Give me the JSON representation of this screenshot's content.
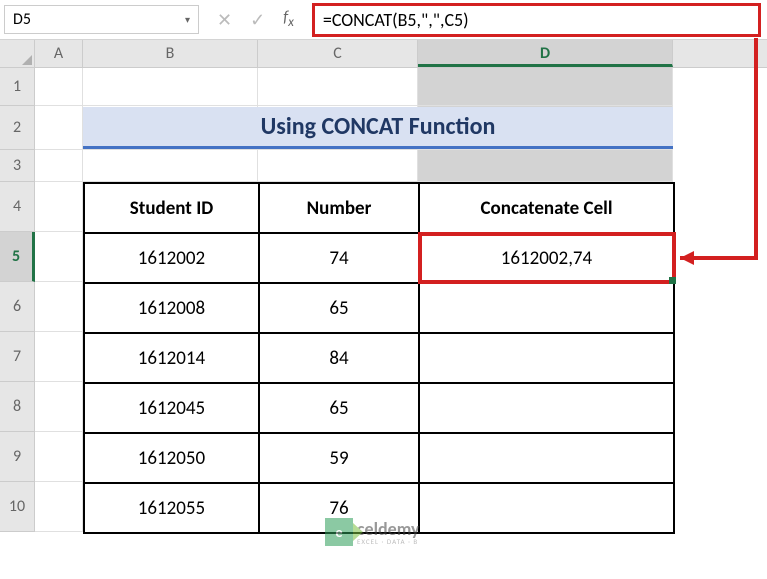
{
  "name_box": "D5",
  "formula": "=CONCAT(B5,\",\",C5)",
  "columns": [
    "A",
    "B",
    "C",
    "D"
  ],
  "rows": [
    "1",
    "2",
    "3",
    "4",
    "5",
    "6",
    "7",
    "8",
    "9",
    "10"
  ],
  "title": "Using CONCAT Function",
  "headers": {
    "b": "Student ID",
    "c": "Number",
    "d": "Concatenate Cell"
  },
  "data": [
    {
      "b": "1612002",
      "c": "74",
      "d": "1612002,74"
    },
    {
      "b": "1612008",
      "c": "65",
      "d": ""
    },
    {
      "b": "1612014",
      "c": "84",
      "d": ""
    },
    {
      "b": "1612045",
      "c": "65",
      "d": ""
    },
    {
      "b": "1612050",
      "c": "59",
      "d": ""
    },
    {
      "b": "1612055",
      "c": "76",
      "d": ""
    }
  ],
  "watermark": {
    "logo": "e",
    "main": "celdemy",
    "sub": "EXCEL · DATA · B"
  },
  "chart_data": {
    "type": "table",
    "title": "Using CONCAT Function",
    "columns": [
      "Student ID",
      "Number",
      "Concatenate Cell"
    ],
    "rows": [
      [
        "1612002",
        74,
        "1612002,74"
      ],
      [
        "1612008",
        65,
        ""
      ],
      [
        "1612014",
        84,
        ""
      ],
      [
        "1612045",
        65,
        ""
      ],
      [
        "1612050",
        59,
        ""
      ],
      [
        "1612055",
        76,
        ""
      ]
    ]
  }
}
